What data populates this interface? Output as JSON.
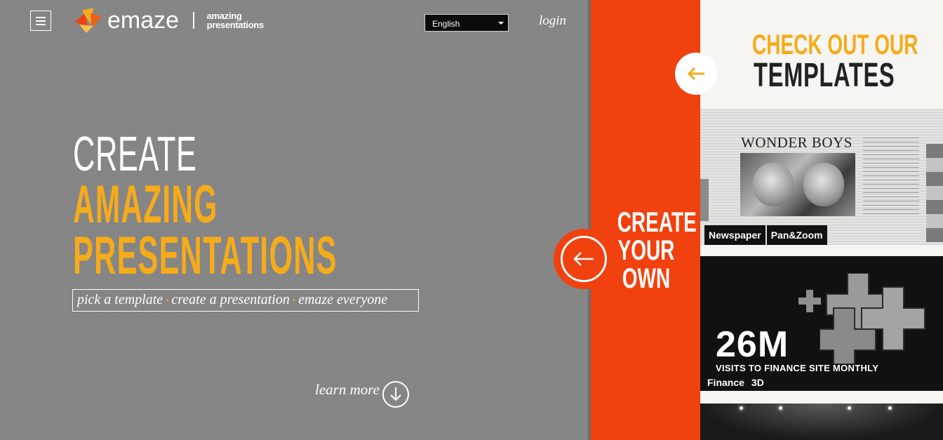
{
  "header": {
    "menu_icon": "hamburger-icon",
    "logo_word": "emaze",
    "logo_tagline_line1": "amazing",
    "logo_tagline_line2": "presentations",
    "language_selected": "English",
    "login_label": "login"
  },
  "hero": {
    "title_line1": "CREATE",
    "title_line2": "AMAZING",
    "title_line3": "PRESENTATIONS",
    "steps": [
      "pick a template",
      "create a presentation",
      "emaze everyone"
    ],
    "learn_more_label": "learn more",
    "learn_more_icon": "arrow-down-circle-icon"
  },
  "create_own": {
    "line1": "CREATE",
    "line2": "YOUR",
    "line3": "OWN",
    "icon": "arrow-left-circle-icon"
  },
  "templates_panel": {
    "heading_line1": "CHECK OUT OUR",
    "heading_line2": "TEMPLATES",
    "back_icon": "arrow-left-icon",
    "cards": [
      {
        "preview_headline": "WONDER BOYS",
        "tags": [
          "Newspaper",
          "Pan&Zoom"
        ]
      },
      {
        "preview_stat": "26M",
        "preview_caption": "VISITS TO FINANCE SITE MONTHLY",
        "tags": [
          "Finance",
          "3D"
        ]
      },
      {
        "tags": []
      }
    ]
  },
  "colors": {
    "accent_orange": "#f0410f",
    "accent_yellow": "#f5ab1a",
    "hero_gray": "#858586"
  }
}
